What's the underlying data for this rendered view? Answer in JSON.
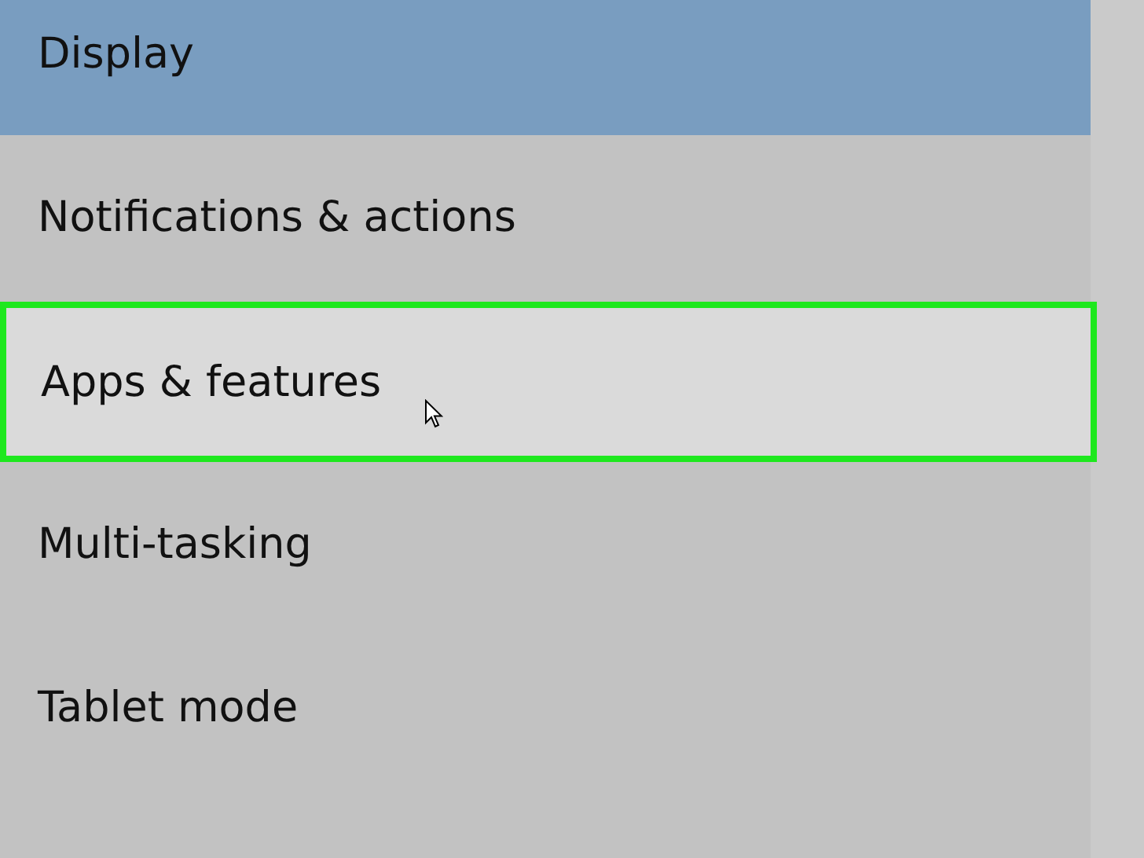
{
  "sidebar": {
    "items": [
      {
        "label": "Display",
        "selected": true,
        "hovered": false,
        "highlighted": false
      },
      {
        "label": "Notifications & actions",
        "selected": false,
        "hovered": false,
        "highlighted": false
      },
      {
        "label": "Apps & features",
        "selected": false,
        "hovered": true,
        "highlighted": true
      },
      {
        "label": "Multi-tasking",
        "selected": false,
        "hovered": false,
        "highlighted": false
      },
      {
        "label": "Tablet mode",
        "selected": false,
        "hovered": false,
        "highlighted": false
      }
    ]
  }
}
